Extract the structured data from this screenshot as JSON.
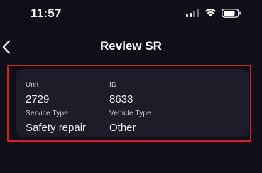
{
  "status_bar": {
    "time": "11:57",
    "icons": [
      "cellular-signal-icon",
      "wifi-icon",
      "battery-icon"
    ]
  },
  "nav": {
    "title": "Review SR",
    "back_icon": "chevron-left-icon"
  },
  "card": {
    "highlight_color": "#e01b22",
    "fields": [
      {
        "label": "Unit",
        "value": "2729"
      },
      {
        "label": "ID",
        "value": "8633"
      },
      {
        "label": "Service Type",
        "value": "Safety repair"
      },
      {
        "label": "Vehicle Type",
        "value": "Other"
      }
    ]
  }
}
